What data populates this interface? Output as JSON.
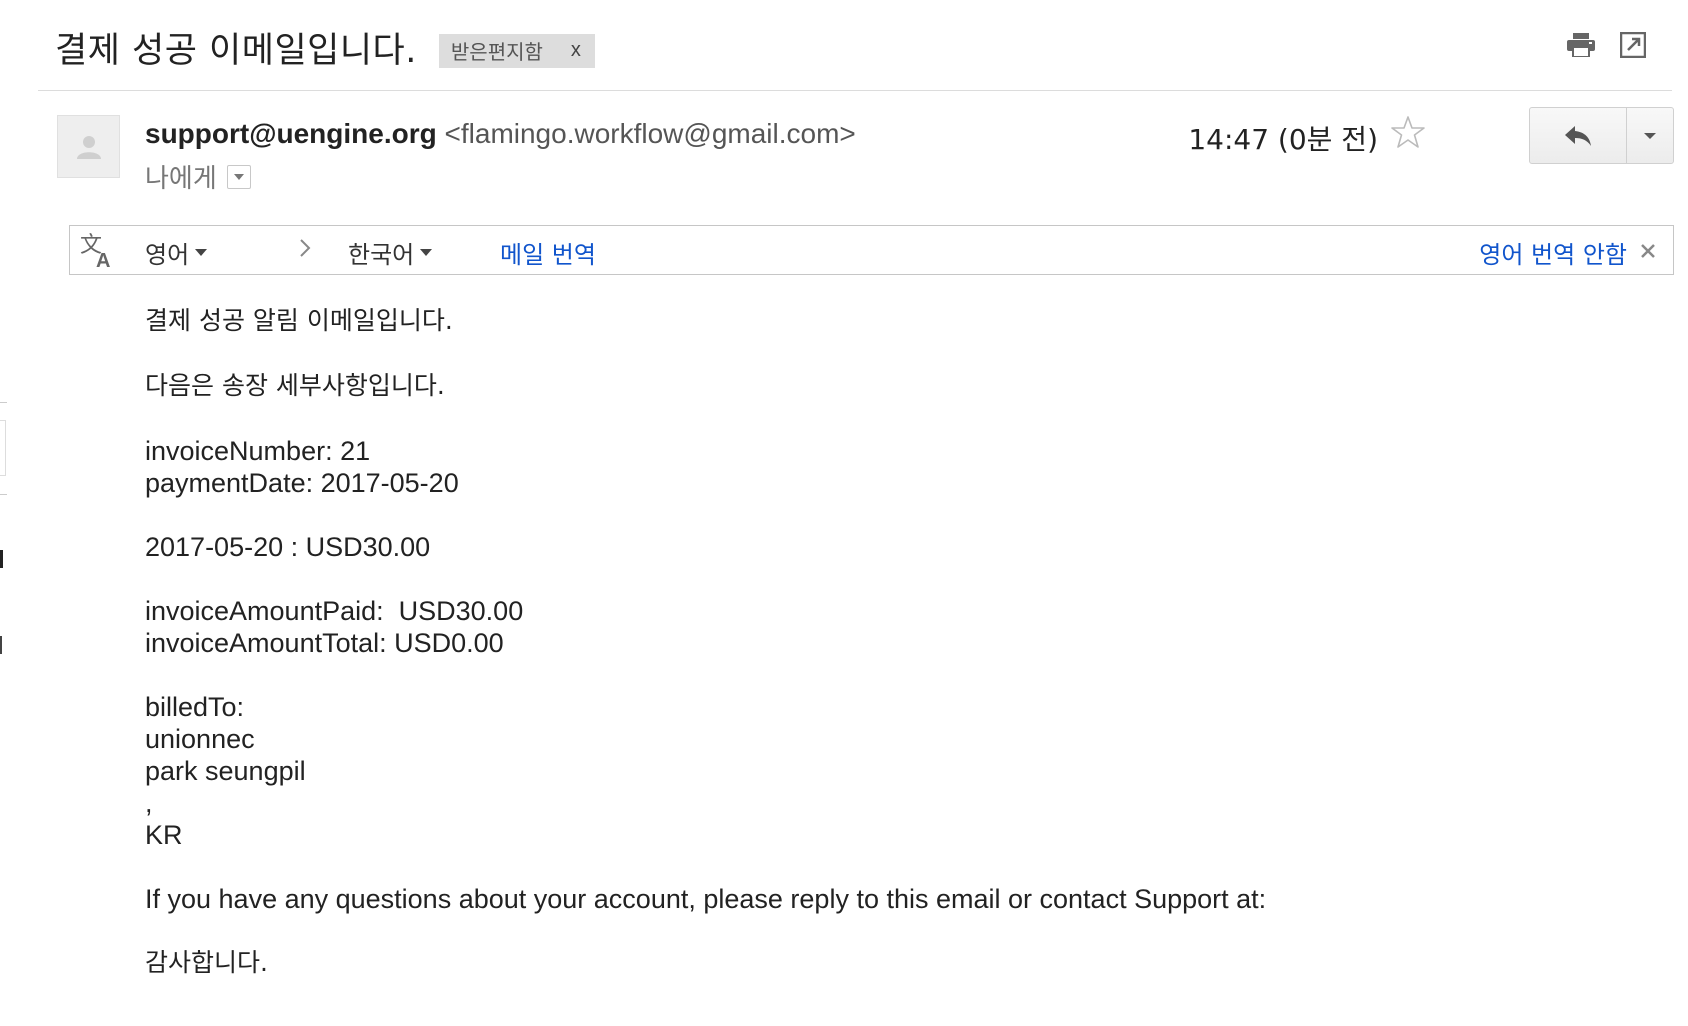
{
  "subject": {
    "title": "결제 성공 이메일입니다.",
    "label": "받은편지함",
    "label_remove": "x"
  },
  "toolbar": {
    "print_icon": "print-icon",
    "popout_icon": "open-in-new-window-icon"
  },
  "message": {
    "sender_name": "support@uengine.org",
    "sender_address": "<flamingo.workflow@gmail.com>",
    "recipient": "나에게",
    "time": "14:47 (0분 전)",
    "starred": false
  },
  "translation": {
    "source_lang": "영어",
    "target_lang": "한국어",
    "translate_label": "메일 번역",
    "turn_off_label": "영어 번역 안함"
  },
  "body": {
    "greeting": "결제 성공 알림 이메일입니다.",
    "intro": "다음은 송장 세부사항입니다.",
    "invoice_number": "invoiceNumber: 21",
    "payment_date": "paymentDate: 2017-05-20",
    "line_item": "2017-05-20 : USD30.00",
    "amount_paid": "invoiceAmountPaid:  USD30.00",
    "amount_total": "invoiceAmountTotal: USD0.00",
    "billed_to_label": "billedTo:",
    "billed_company": "unionnec",
    "billed_name": "park seungpil",
    "billed_comma": ",",
    "billed_country": "KR",
    "support_text": "If you have any questions about your account, please reply to this email or contact Support at:",
    "thanks": "감사합니다."
  }
}
